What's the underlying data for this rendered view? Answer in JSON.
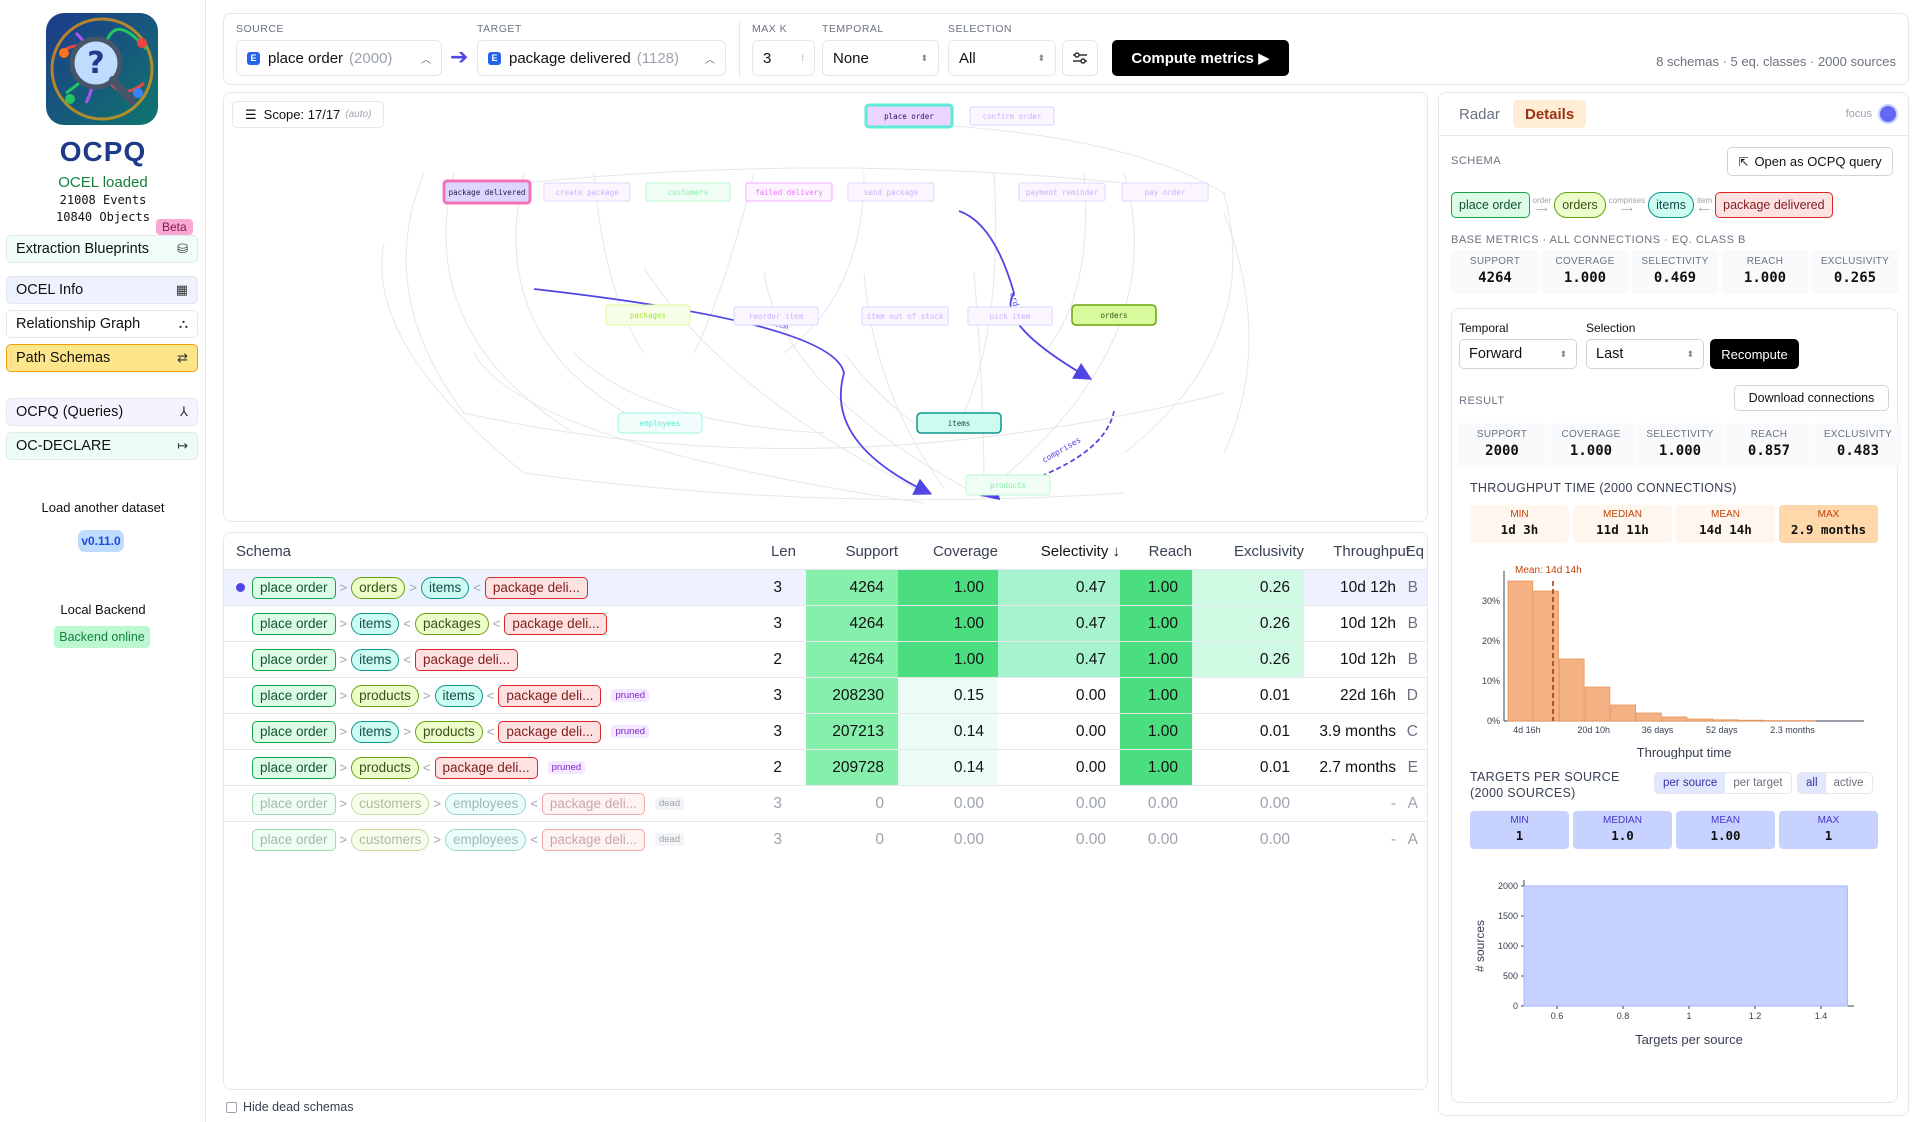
{
  "sidebar": {
    "app_title": "OCPQ",
    "status": "OCEL loaded",
    "events": "21008 Events",
    "objects": "10840 Objects",
    "beta": "Beta",
    "nav": [
      {
        "label": "Extraction Blueprints",
        "icon": "database-icon"
      },
      {
        "label": "OCEL Info",
        "icon": "table-icon"
      },
      {
        "label": "Relationship Graph",
        "icon": "graph-icon"
      },
      {
        "label": "Path Schemas",
        "icon": "route-icon"
      },
      {
        "label": "OCPQ (Queries)",
        "icon": "query-tree-icon"
      },
      {
        "label": "OC-DECLARE",
        "icon": "arrows-icon"
      }
    ],
    "load_another": "Load another dataset",
    "version": "v0.11.0",
    "local_backend": "Local Backend",
    "backend_status": "Backend online"
  },
  "toolbar": {
    "source_label": "SOURCE",
    "source_value": "place order",
    "source_count": "(2000)",
    "target_label": "TARGET",
    "target_value": "package delivered",
    "target_count": "(1128)",
    "maxk_label": "MAX K",
    "maxk_value": "3",
    "temporal_label": "TEMPORAL",
    "temporal_value": "None",
    "selection_label": "SELECTION",
    "selection_value": "All",
    "compute_label": "Compute metrics ▶",
    "summary": "8 schemas · 5 eq. classes · 2000 sources"
  },
  "graph": {
    "scope_label": "Scope: 17/17",
    "scope_auto": "(auto)",
    "nodes": {
      "place_order": "place order",
      "confirm_order": "confirm order",
      "package_delivered": "package delivered",
      "create_package": "create package",
      "customers": "customers",
      "failed_delivery": "failed delivery",
      "send_package": "send package",
      "payment_reminder": "payment reminder",
      "pay_order": "pay order",
      "packages": "packages",
      "reorder_item": "reorder item",
      "item_out_of_stock": "item out of stock",
      "pick_item": "pick item",
      "orders": "orders",
      "employees": "employees",
      "items": "items",
      "products": "products"
    },
    "edge_labels": {
      "item": "item",
      "order": "order",
      "comprises": "comprises"
    }
  },
  "table": {
    "headers": [
      "Schema",
      "Len",
      "Support",
      "Coverage",
      "Selectivity ↓",
      "Reach",
      "Exclusivity",
      "Throughput",
      "Eq"
    ],
    "rows": [
      {
        "path": [
          [
            "place order",
            "green"
          ],
          [
            ">",
            "sep"
          ],
          [
            "orders",
            "lime"
          ],
          [
            ">",
            "sep"
          ],
          [
            "items",
            "teal"
          ],
          [
            "<",
            "sep"
          ],
          [
            "package deli...",
            "red"
          ]
        ],
        "tag": "",
        "len": "3",
        "support": "4264",
        "coverage": "1.00",
        "selectivity": "0.47",
        "reach": "1.00",
        "exclusivity": "0.26",
        "throughput": "10d 12h",
        "eq": "B"
      },
      {
        "path": [
          [
            "place order",
            "green"
          ],
          [
            ">",
            "sep"
          ],
          [
            "items",
            "teal"
          ],
          [
            "<",
            "sep"
          ],
          [
            "packages",
            "lime"
          ],
          [
            "<",
            "sep"
          ],
          [
            "package deli...",
            "red"
          ]
        ],
        "tag": "",
        "len": "3",
        "support": "4264",
        "coverage": "1.00",
        "selectivity": "0.47",
        "reach": "1.00",
        "exclusivity": "0.26",
        "throughput": "10d 12h",
        "eq": "B"
      },
      {
        "path": [
          [
            "place order",
            "green"
          ],
          [
            ">",
            "sep"
          ],
          [
            "items",
            "teal"
          ],
          [
            "<",
            "sep"
          ],
          [
            "package deli...",
            "red"
          ]
        ],
        "tag": "",
        "len": "2",
        "support": "4264",
        "coverage": "1.00",
        "selectivity": "0.47",
        "reach": "1.00",
        "exclusivity": "0.26",
        "throughput": "10d 12h",
        "eq": "B"
      },
      {
        "path": [
          [
            "place order",
            "green"
          ],
          [
            ">",
            "sep"
          ],
          [
            "products",
            "lime"
          ],
          [
            ">",
            "sep"
          ],
          [
            "items",
            "teal"
          ],
          [
            "<",
            "sep"
          ],
          [
            "package deli...",
            "red"
          ]
        ],
        "tag": "pruned",
        "len": "3",
        "support": "208230",
        "coverage": "0.15",
        "selectivity": "0.00",
        "reach": "1.00",
        "exclusivity": "0.01",
        "throughput": "22d 16h",
        "eq": "D"
      },
      {
        "path": [
          [
            "place order",
            "green"
          ],
          [
            ">",
            "sep"
          ],
          [
            "items",
            "teal"
          ],
          [
            ">",
            "sep"
          ],
          [
            "products",
            "lime"
          ],
          [
            "<",
            "sep"
          ],
          [
            "package deli...",
            "red"
          ]
        ],
        "tag": "pruned",
        "len": "3",
        "support": "207213",
        "coverage": "0.14",
        "selectivity": "0.00",
        "reach": "1.00",
        "exclusivity": "0.01",
        "throughput": "3.9 months",
        "eq": "C"
      },
      {
        "path": [
          [
            "place order",
            "green"
          ],
          [
            ">",
            "sep"
          ],
          [
            "products",
            "lime"
          ],
          [
            "<",
            "sep"
          ],
          [
            "package deli...",
            "red"
          ]
        ],
        "tag": "pruned",
        "len": "2",
        "support": "209728",
        "coverage": "0.14",
        "selectivity": "0.00",
        "reach": "1.00",
        "exclusivity": "0.01",
        "throughput": "2.7 months",
        "eq": "E"
      },
      {
        "path": [
          [
            "place order",
            "green"
          ],
          [
            ">",
            "sep"
          ],
          [
            "customers",
            "lime"
          ],
          [
            ">",
            "sep"
          ],
          [
            "employees",
            "teal"
          ],
          [
            "<",
            "sep"
          ],
          [
            "package deli...",
            "red"
          ]
        ],
        "tag": "dead",
        "len": "3",
        "support": "0",
        "coverage": "0.00",
        "selectivity": "0.00",
        "reach": "0.00",
        "exclusivity": "0.00",
        "throughput": "-",
        "eq": "A"
      },
      {
        "path": [
          [
            "place order",
            "green"
          ],
          [
            ">",
            "sep"
          ],
          [
            "customers",
            "lime"
          ],
          [
            ">",
            "sep"
          ],
          [
            "employees",
            "teal"
          ],
          [
            "<",
            "sep"
          ],
          [
            "package deli...",
            "red"
          ]
        ],
        "tag": "dead",
        "len": "3",
        "support": "0",
        "coverage": "0.00",
        "selectivity": "0.00",
        "reach": "0.00",
        "exclusivity": "0.00",
        "throughput": "-",
        "eq": "A"
      }
    ],
    "hide_dead": "Hide dead schemas"
  },
  "details": {
    "tabs": [
      "Radar",
      "Details"
    ],
    "focus": "focus",
    "schema_label": "SCHEMA",
    "open_query": "Open as OCPQ query",
    "schema_chips": [
      "place order",
      "orders",
      "items",
      "package delivered"
    ],
    "schema_edges": [
      "order",
      "comprises",
      "item"
    ],
    "base_label": "BASE METRICS · ALL CONNECTIONS · EQ. CLASS B",
    "base_metrics": [
      {
        "k": "SUPPORT",
        "v": "4264"
      },
      {
        "k": "COVERAGE",
        "v": "1.000"
      },
      {
        "k": "SELECTIVITY",
        "v": "0.469"
      },
      {
        "k": "REACH",
        "v": "1.000"
      },
      {
        "k": "EXCLUSIVITY",
        "v": "0.265"
      }
    ],
    "temporal_label": "Temporal",
    "temporal_value": "Forward",
    "selection_label": "Selection",
    "selection_value": "Last",
    "recompute": "Recompute",
    "result_label": "RESULT",
    "download": "Download connections",
    "result_metrics": [
      {
        "k": "SUPPORT",
        "v": "2000"
      },
      {
        "k": "COVERAGE",
        "v": "1.000"
      },
      {
        "k": "SELECTIVITY",
        "v": "1.000"
      },
      {
        "k": "REACH",
        "v": "0.857"
      },
      {
        "k": "EXCLUSIVITY",
        "v": "0.483"
      }
    ],
    "tp_title": "THROUGHPUT TIME (2000 CONNECTIONS)",
    "tp_stats": [
      {
        "k": "MIN",
        "v": "1d 3h"
      },
      {
        "k": "MEDIAN",
        "v": "11d 11h"
      },
      {
        "k": "MEAN",
        "v": "14d 14h"
      },
      {
        "k": "MAX",
        "v": "2.9 months"
      }
    ],
    "ts_title_1": "TARGETS PER SOURCE",
    "ts_title_2": "(2000 SOURCES)",
    "ts_toggle": [
      "per source",
      "per target"
    ],
    "ts_toggle2": [
      "all",
      "active"
    ],
    "ts_stats": [
      {
        "k": "MIN",
        "v": "1"
      },
      {
        "k": "MEDIAN",
        "v": "1.0"
      },
      {
        "k": "MEAN",
        "v": "1.00"
      },
      {
        "k": "MAX",
        "v": "1"
      }
    ]
  },
  "colors": {
    "accent": "#4f46e5",
    "brand": "#1e3a8a",
    "throughput": "#f4b183",
    "targets": "#c7d2fe"
  },
  "chart_data": [
    {
      "type": "bar",
      "xlabel": "Throughput time",
      "ylabel": "",
      "x_ticks": [
        "4d 16h",
        "20d 10h",
        "36 days",
        "52 days",
        "2.3 months"
      ],
      "y_ticks": [
        "0%",
        "10%",
        "20%",
        "30%"
      ],
      "ylim": [
        0,
        35
      ],
      "mean_label": "Mean: 14d 14h",
      "values": [
        35,
        32.5,
        15.5,
        8.5,
        4,
        2,
        1,
        0.5,
        0.3,
        0.2,
        0.1,
        0.1
      ]
    },
    {
      "type": "bar",
      "xlabel": "Targets per source",
      "ylabel": "# sources",
      "x_ticks": [
        "0.6",
        "0.8",
        "1",
        "1.2",
        "1.4"
      ],
      "y_ticks": [
        "0",
        "500",
        "1000",
        "1500",
        "2000"
      ],
      "ylim": [
        0,
        2000
      ],
      "xlim": [
        0.5,
        1.5
      ],
      "values": [
        2000
      ]
    }
  ]
}
